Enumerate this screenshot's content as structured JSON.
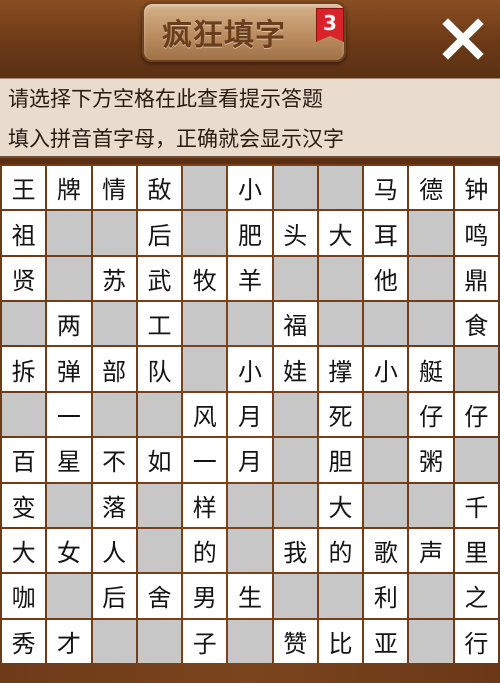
{
  "header": {
    "title": "疯狂填字",
    "level": "3",
    "close_icon": "close-icon"
  },
  "hints": {
    "line1": "请选择下方空格在此查看提示答题",
    "line2": "填入拼音首字母，正确就会显示汉字"
  },
  "colors": {
    "filled_cell": "#ffffff",
    "blank_cell": "#c7c7c7",
    "board_wood": "#6e3b19",
    "hint_bg": "#e9dccf",
    "badge_red": "#d8232a"
  },
  "grid": {
    "rows": 11,
    "cols": 11,
    "cells": [
      [
        "王",
        "牌",
        "情",
        "敌",
        "#",
        "小",
        "#",
        "#",
        "马",
        "德",
        "钟"
      ],
      [
        "祖",
        "#",
        "#",
        "后",
        "#",
        "肥",
        "头",
        "大",
        "耳",
        "#",
        "鸣"
      ],
      [
        "贤",
        "#",
        "苏",
        "武",
        "牧",
        "羊",
        "#",
        "#",
        "他",
        "#",
        "鼎"
      ],
      [
        "#",
        "两",
        "#",
        "工",
        "#",
        "#",
        "福",
        "#",
        "#",
        "#",
        "食"
      ],
      [
        "拆",
        "弹",
        "部",
        "队",
        "#",
        "小",
        "娃",
        "撑",
        "小",
        "艇",
        "#"
      ],
      [
        "#",
        "一",
        "#",
        "#",
        "风",
        "月",
        "#",
        "死",
        "#",
        "仔",
        "仔"
      ],
      [
        "百",
        "星",
        "不",
        "如",
        "一",
        "月",
        "#",
        "胆",
        "#",
        "粥",
        "#"
      ],
      [
        "变",
        "#",
        "落",
        "#",
        "样",
        "#",
        "#",
        "大",
        "#",
        "#",
        "千"
      ],
      [
        "大",
        "女",
        "人",
        "#",
        "的",
        "#",
        "我",
        "的",
        "歌",
        "声",
        "里"
      ],
      [
        "咖",
        "#",
        "后",
        "舍",
        "男",
        "生",
        "#",
        "#",
        "利",
        "#",
        "之"
      ],
      [
        "秀",
        "才",
        "#",
        "#",
        "子",
        "#",
        "赞",
        "比",
        "亚",
        "#",
        "行"
      ]
    ]
  }
}
